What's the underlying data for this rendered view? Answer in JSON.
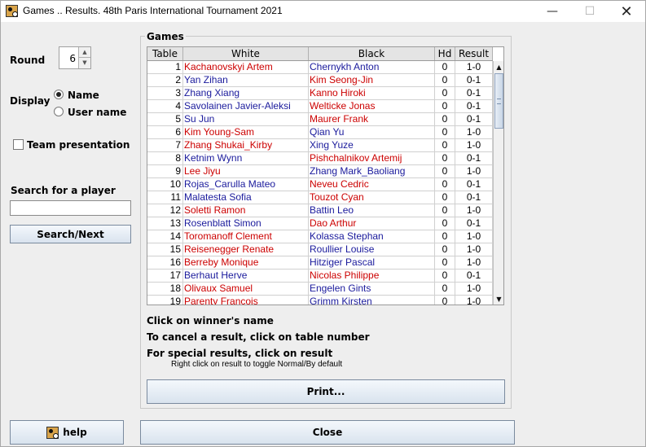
{
  "window": {
    "title": "Games .. Results. 48th Paris International Tournament 2021",
    "minimize": "—",
    "maximize": "☐",
    "close": "✕"
  },
  "left_panel": {
    "round_label": "Round",
    "round_value": "6",
    "display_label": "Display",
    "display_options": [
      "Name",
      "User name"
    ],
    "display_selected": "Name",
    "team_presentation_label": "Team presentation",
    "team_presentation_checked": false,
    "search_label": "Search for a player",
    "search_value": "",
    "search_button": "Search/Next"
  },
  "games": {
    "title": "Games",
    "columns": [
      "Table",
      "White",
      "Black",
      "Hd",
      "Result"
    ],
    "rows": [
      {
        "table": "1",
        "white": "Kachanovskyi Artem",
        "white_color": "red",
        "black": "Chernykh Anton",
        "black_color": "blue",
        "hd": "0",
        "result": "1-0"
      },
      {
        "table": "2",
        "white": "Yan Zihan",
        "white_color": "blue",
        "black": "Kim Seong-Jin",
        "black_color": "red",
        "hd": "0",
        "result": "0-1"
      },
      {
        "table": "3",
        "white": "Zhang Xiang",
        "white_color": "blue",
        "black": "Kanno Hiroki",
        "black_color": "red",
        "hd": "0",
        "result": "0-1"
      },
      {
        "table": "4",
        "white": "Savolainen Javier-Aleksi",
        "white_color": "blue",
        "black": "Welticke Jonas",
        "black_color": "red",
        "hd": "0",
        "result": "0-1"
      },
      {
        "table": "5",
        "white": "Su Jun",
        "white_color": "blue",
        "black": "Maurer Frank",
        "black_color": "red",
        "hd": "0",
        "result": "0-1"
      },
      {
        "table": "6",
        "white": "Kim Young-Sam",
        "white_color": "red",
        "black": "Qian Yu",
        "black_color": "blue",
        "hd": "0",
        "result": "1-0"
      },
      {
        "table": "7",
        "white": "Zhang Shukai_Kirby",
        "white_color": "red",
        "black": "Xing Yuze",
        "black_color": "blue",
        "hd": "0",
        "result": "1-0"
      },
      {
        "table": "8",
        "white": "Ketnim Wynn",
        "white_color": "blue",
        "black": "Pishchalnikov Artemij",
        "black_color": "red",
        "hd": "0",
        "result": "0-1"
      },
      {
        "table": "9",
        "white": "Lee Jiyu",
        "white_color": "red",
        "black": "Zhang Mark_Baoliang",
        "black_color": "blue",
        "hd": "0",
        "result": "1-0"
      },
      {
        "table": "10",
        "white": "Rojas_Carulla Mateo",
        "white_color": "blue",
        "black": "Neveu Cedric",
        "black_color": "red",
        "hd": "0",
        "result": "0-1"
      },
      {
        "table": "11",
        "white": "Malatesta Sofia",
        "white_color": "blue",
        "black": "Touzot Cyan",
        "black_color": "red",
        "hd": "0",
        "result": "0-1"
      },
      {
        "table": "12",
        "white": "Soletti Ramon",
        "white_color": "red",
        "black": "Battin Leo",
        "black_color": "blue",
        "hd": "0",
        "result": "1-0"
      },
      {
        "table": "13",
        "white": "Rosenblatt Simon",
        "white_color": "blue",
        "black": "Dao Arthur",
        "black_color": "red",
        "hd": "0",
        "result": "0-1"
      },
      {
        "table": "14",
        "white": "Toromanoff Clement",
        "white_color": "red",
        "black": "Kolassa Stephan",
        "black_color": "blue",
        "hd": "0",
        "result": "1-0"
      },
      {
        "table": "15",
        "white": "Reisenegger Renate",
        "white_color": "red",
        "black": "Roullier Louise",
        "black_color": "blue",
        "hd": "0",
        "result": "1-0"
      },
      {
        "table": "16",
        "white": "Berreby Monique",
        "white_color": "red",
        "black": "Hitziger Pascal",
        "black_color": "blue",
        "hd": "0",
        "result": "1-0"
      },
      {
        "table": "17",
        "white": "Berhaut Herve",
        "white_color": "blue",
        "black": "Nicolas Philippe",
        "black_color": "red",
        "hd": "0",
        "result": "0-1"
      },
      {
        "table": "18",
        "white": "Olivaux Samuel",
        "white_color": "red",
        "black": "Engelen Gints",
        "black_color": "blue",
        "hd": "0",
        "result": "1-0"
      },
      {
        "table": "19",
        "white": "Parenty Francois",
        "white_color": "red",
        "black": "Grimm Kirsten",
        "black_color": "blue",
        "hd": "0",
        "result": "1-0"
      }
    ],
    "instructions": {
      "winner": "Click on winner's name",
      "cancel": "To cancel a result, click on table number",
      "special": "For special results, click on result",
      "toggle": "Right click on result to toggle Normal/By default"
    },
    "print_button": "Print..."
  },
  "footer": {
    "help_button": "help",
    "close_button": "Close"
  },
  "colors": {
    "red_player": "#cc0000",
    "blue_player": "#1a1a9c",
    "background": "#eeeeee"
  }
}
